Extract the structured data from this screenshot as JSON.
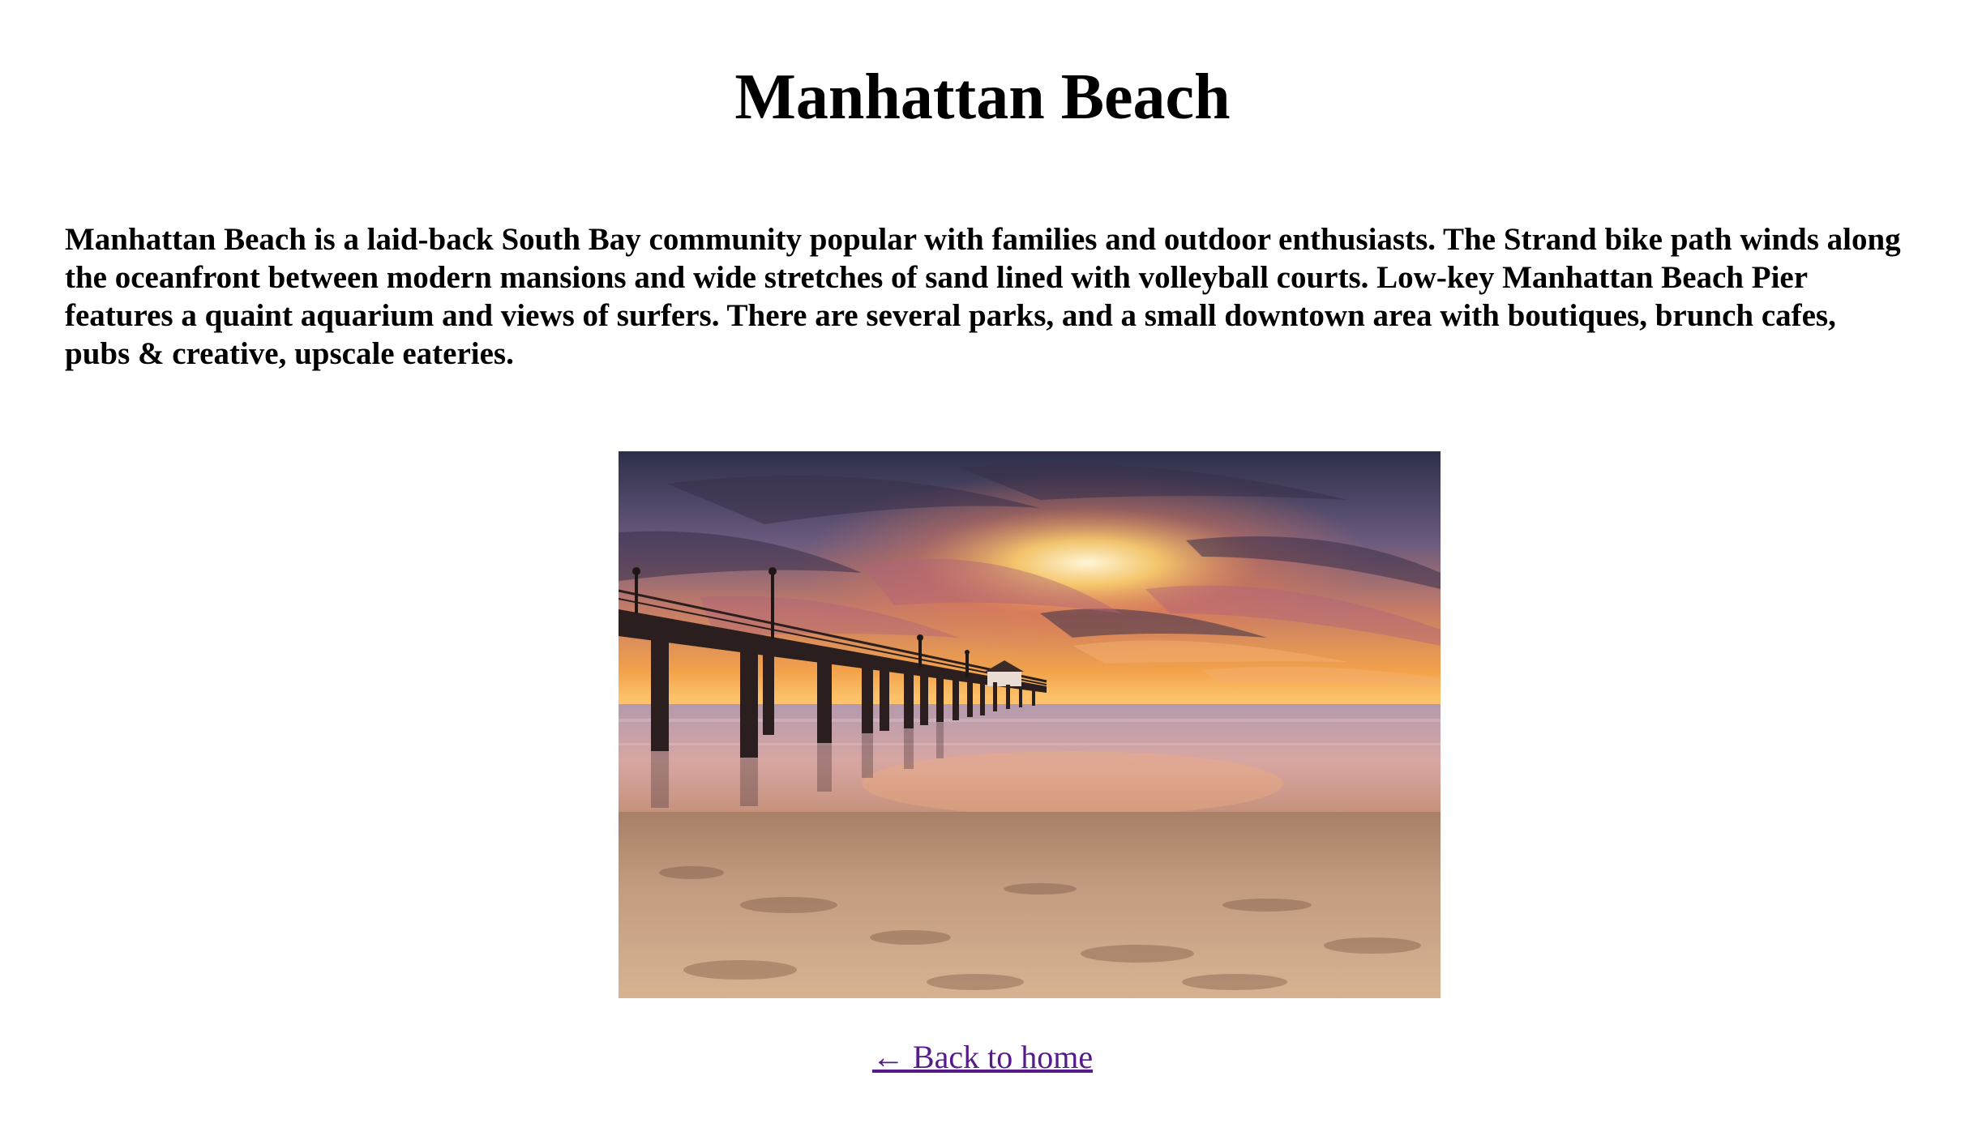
{
  "page": {
    "title": "Manhattan Beach",
    "description": "Manhattan Beach is a laid-back South Bay community popular with families and outdoor enthusiasts. The Strand bike path winds along the oceanfront between modern mansions and wide stretches of sand lined with volleyball courts. Low-key Manhattan Beach Pier features a quaint aquarium and views of surfers. There are several parks, and a small downtown area with boutiques, brunch cafes, pubs & creative, upscale eateries.",
    "back_link": "← Back to home"
  },
  "colors": {
    "link": "#551a8b",
    "text": "#000000",
    "background": "#ffffff"
  }
}
